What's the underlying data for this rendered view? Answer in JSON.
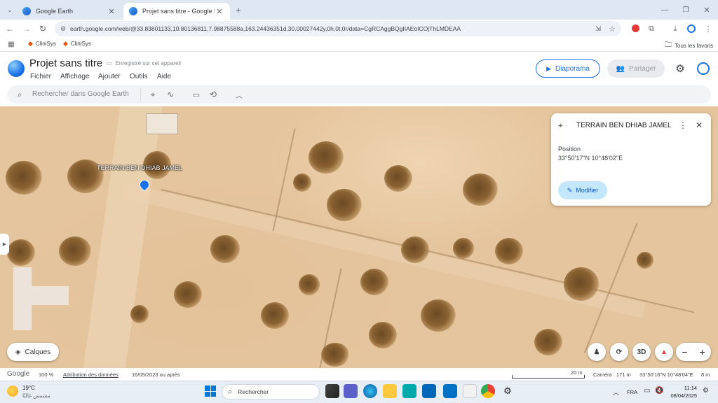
{
  "browser": {
    "tabs": [
      {
        "label": "Google Earth",
        "active": false
      },
      {
        "label": "Projet sans titre - Google Earth",
        "active": true
      }
    ],
    "url": "earth.google.com/web/@33.83801133,10.80136811,7.98875588a,163.24436351d,30.00027442y,0h,0t,0r/data=CgRCAggBQgIIAEoICOjThLMDEAA",
    "bookmarks": [
      "CliniSys",
      "CliniSys"
    ],
    "all_bookmarks": "Tous les favoris"
  },
  "earth": {
    "project_title": "Projet sans titre",
    "save_status": "Enregistré sur cet appareil",
    "menu": [
      "Fichier",
      "Affichage",
      "Ajouter",
      "Outils",
      "Aide"
    ],
    "slideshow_label": "Diaporama",
    "share_label": "Partager",
    "search_placeholder": "Rechercher dans Google Earth"
  },
  "map": {
    "placemark_label": "TERRAIN BEN DHIAB JAMEL",
    "layers_label": "Calques",
    "btn_3d": "3D",
    "zoom_minus": "−",
    "zoom_plus": "+"
  },
  "infocard": {
    "title": "TERRAIN BEN DHIAB JAMEL",
    "position_label": "Position",
    "position_value": "33°50'17\"N 10°48'02\"E",
    "edit_label": "Modifier"
  },
  "status": {
    "logo": "Google",
    "zoom": "100 %",
    "attribution": "Attribution des données",
    "date": "16/05/2023 ou après",
    "scale": "20 m",
    "camera": "Caméra : 171 m",
    "coords": "33°50'16\"N 10°48'04\"E",
    "elevation": "8 m"
  },
  "taskbar": {
    "temp": "19°C",
    "weather": "مشمس غالبًا",
    "search": "Rechercher",
    "lang": "FRA",
    "time": "11:14",
    "date": "08/04/2025"
  },
  "colors": {
    "accent": "#1a73e8",
    "map_sand": "#e5c59d"
  }
}
